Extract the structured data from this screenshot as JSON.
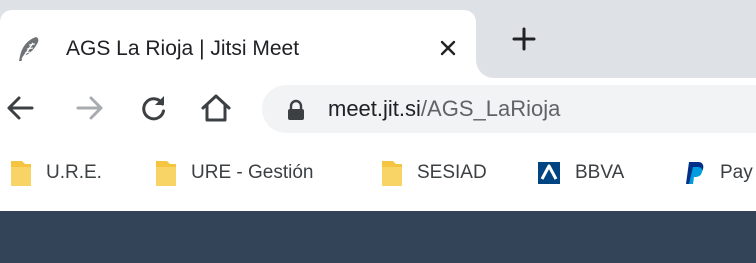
{
  "tab": {
    "title": "AGS La Rioja | Jitsi Meet",
    "favicon": "feather-icon",
    "close_icon": "close-icon",
    "new_tab_icon": "plus-icon"
  },
  "toolbar": {
    "back_icon": "arrow-left-icon",
    "forward_icon": "arrow-right-icon",
    "reload_icon": "reload-icon",
    "home_icon": "home-icon",
    "lock_icon": "lock-icon",
    "url_host": "meet.jit.si",
    "url_path": "/AGS_LaRioja"
  },
  "bookmarks": [
    {
      "label": "U.R.E.",
      "icon": "folder-icon"
    },
    {
      "label": "URE - Gestión",
      "icon": "folder-icon"
    },
    {
      "label": "SESIAD",
      "icon": "folder-icon"
    },
    {
      "label": "BBVA",
      "icon": "bbva-icon"
    },
    {
      "label": "Pay",
      "icon": "paypal-icon"
    }
  ],
  "colors": {
    "tabstrip": "#dee1e6",
    "omnibox": "#f1f3f4",
    "folder": "#f5c542",
    "bbva": "#004481",
    "paypal": "#003087",
    "page_header": "#344458"
  }
}
